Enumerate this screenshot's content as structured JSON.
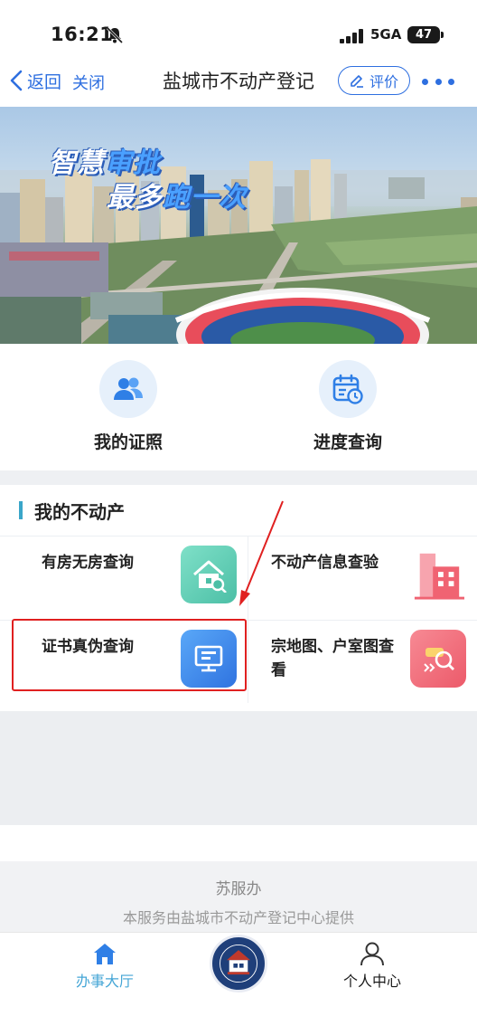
{
  "status_bar": {
    "time": "16:21",
    "network": "5GA",
    "battery": "47"
  },
  "nav": {
    "back_label": "返回",
    "close_label": "关闭",
    "title": "盐城市不动产登记",
    "rate_label": "评价"
  },
  "banner": {
    "slogan_part1": "智慧",
    "slogan_part1_hl": "审批",
    "slogan_part2": "最多",
    "slogan_part2_hl": "跑一次"
  },
  "quick": [
    {
      "label": "我的证照",
      "icon": "people-icon"
    },
    {
      "label": "进度查询",
      "icon": "calendar-clock-icon"
    }
  ],
  "section": {
    "title": "我的不动产"
  },
  "services": [
    {
      "label": "有房无房查询",
      "icon": "house-search-icon",
      "color": "#5ccfb8"
    },
    {
      "label": "不动产信息查验",
      "icon": "building-icon",
      "color": "#f05a6a"
    },
    {
      "label": "证书真伪查询",
      "icon": "monitor-certificate-icon",
      "color": "#3f8ef2"
    },
    {
      "label": "宗地图、户室图查看",
      "icon": "map-search-icon",
      "color": "#f06d7a"
    }
  ],
  "footer": {
    "brand": "苏服办",
    "description": "本服务由盐城市不动产登记中心提供"
  },
  "tabs": [
    {
      "label": "办事大厅",
      "icon": "home-icon",
      "active": true
    },
    {
      "label": "个人中心",
      "icon": "user-icon",
      "active": false
    }
  ],
  "colors": {
    "accent": "#2e6fe0",
    "highlight": "#e02020",
    "tab_active": "#45a6d6"
  }
}
